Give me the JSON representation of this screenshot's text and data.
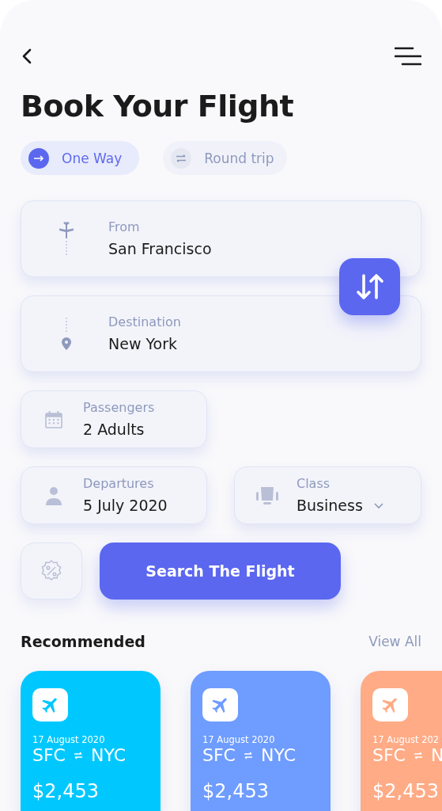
{
  "header": {
    "title": "Book Your Flight"
  },
  "trip_types": [
    {
      "label": "One Way",
      "kind": "oneway",
      "selected": true
    },
    {
      "label": "Round trip",
      "kind": "round",
      "selected": false
    }
  ],
  "route": [
    {
      "label": "From",
      "value": "San Francisco",
      "kind": "origin"
    },
    {
      "label": "Destination",
      "value": "New York",
      "kind": "destination"
    }
  ],
  "details": [
    {
      "label": "Passengers",
      "value": "2 Adults",
      "kind": "calendar",
      "dropdown": false
    },
    {
      "label": "Departures",
      "value": "5 July 2020",
      "kind": "person",
      "dropdown": false
    },
    {
      "label": "Class",
      "value": "Business",
      "kind": "seat",
      "dropdown": true
    }
  ],
  "search_button": "Search The Flight",
  "recommended": {
    "title": "Recommended",
    "link": "View All",
    "flights": [
      {
        "date": "17 August 2020",
        "from": "SFC",
        "to": "NYC",
        "price": "$2,453",
        "color": "#00c8ff"
      },
      {
        "date": "17 August 2020",
        "from": "SFC",
        "to": "NYC",
        "price": "$2,453",
        "color": "#6e9cff"
      },
      {
        "date": "17 August 202",
        "from": "SFC",
        "to": "N",
        "price": "$2,453",
        "color": "#ffab86"
      }
    ]
  }
}
